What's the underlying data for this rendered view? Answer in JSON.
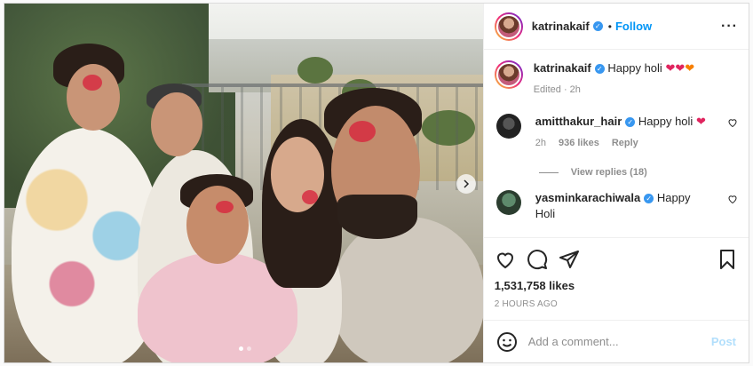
{
  "post": {
    "author": "katrinakaif",
    "follow_label": "Follow",
    "separator": "•",
    "more_icon": "more-horizontal-icon",
    "caption": {
      "username": "katrinakaif",
      "text": "Happy holi",
      "emojis": "❤❤❤",
      "edited": "Edited · 2h"
    },
    "comments": [
      {
        "username": "amitthakur_hair",
        "text": "Happy holi",
        "emoji": "❤",
        "time": "2h",
        "likes": "936 likes",
        "reply": "Reply"
      },
      {
        "username": "yasminkarachiwala",
        "text": "Happy Holi"
      }
    ],
    "view_replies": "View replies (18)",
    "likes_count": "1,531,758 likes",
    "posted_ago": "2 HOURS AGO",
    "comment_placeholder": "Add a comment...",
    "post_label": "Post"
  },
  "colors": {
    "accent": "#0095f6",
    "verified": "#3897f0",
    "heart": "#e0245e",
    "post_disabled": "#b2dffc"
  },
  "carousel": {
    "slides": 2,
    "current": 1
  }
}
